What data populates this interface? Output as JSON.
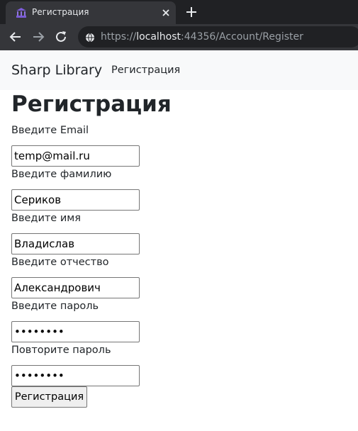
{
  "browser": {
    "tab_title": "Регистрация",
    "url_scheme": "https://",
    "url_host": "localhost",
    "url_rest": ":44356/Account/Register",
    "icons": {
      "favicon": "library-building-icon",
      "close": "close-icon",
      "new_tab": "plus-icon",
      "back": "arrow-left-icon",
      "forward": "arrow-right-icon",
      "reload": "reload-icon",
      "site_info": "globe-icon"
    }
  },
  "navbar": {
    "brand": "Sharp Library",
    "link": "Регистрация"
  },
  "page": {
    "title": "Регистрация",
    "fields": [
      {
        "label": "Введите Email",
        "value": "temp@mail.ru",
        "type": "email"
      },
      {
        "label": "Введите фамилию",
        "value": "Сериков",
        "type": "text"
      },
      {
        "label": "Введите имя",
        "value": "Владислав",
        "type": "text"
      },
      {
        "label": "Введите отчество",
        "value": "Александрович",
        "type": "text"
      },
      {
        "label": "Введите пароль",
        "value": "12345678",
        "type": "password"
      },
      {
        "label": "Повторите пароль",
        "value": "12345678",
        "type": "password"
      }
    ],
    "submit_label": "Регистрация"
  },
  "colors": {
    "tabstrip": "#202124",
    "toolbar": "#35363a",
    "navbar_bg": "#f8f9fa",
    "text": "#212529"
  }
}
